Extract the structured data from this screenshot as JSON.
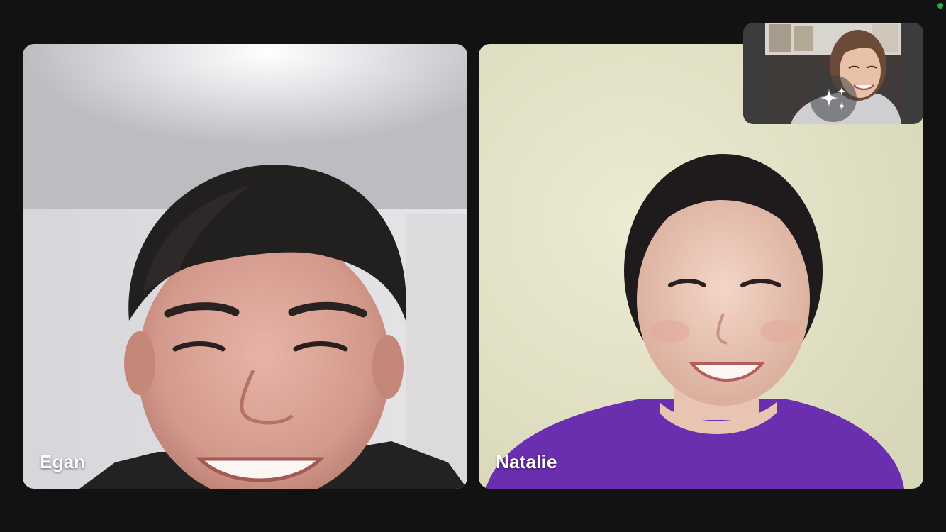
{
  "participants": [
    {
      "name": "Egan"
    },
    {
      "name": "Natalie"
    }
  ],
  "self_view": {
    "effects_icon": "sparkle-icon"
  },
  "colors": {
    "background": "#121212",
    "self_view_background": "#3c3c3c",
    "recording_indicator": "#1fb443",
    "label_text": "#ffffff"
  }
}
